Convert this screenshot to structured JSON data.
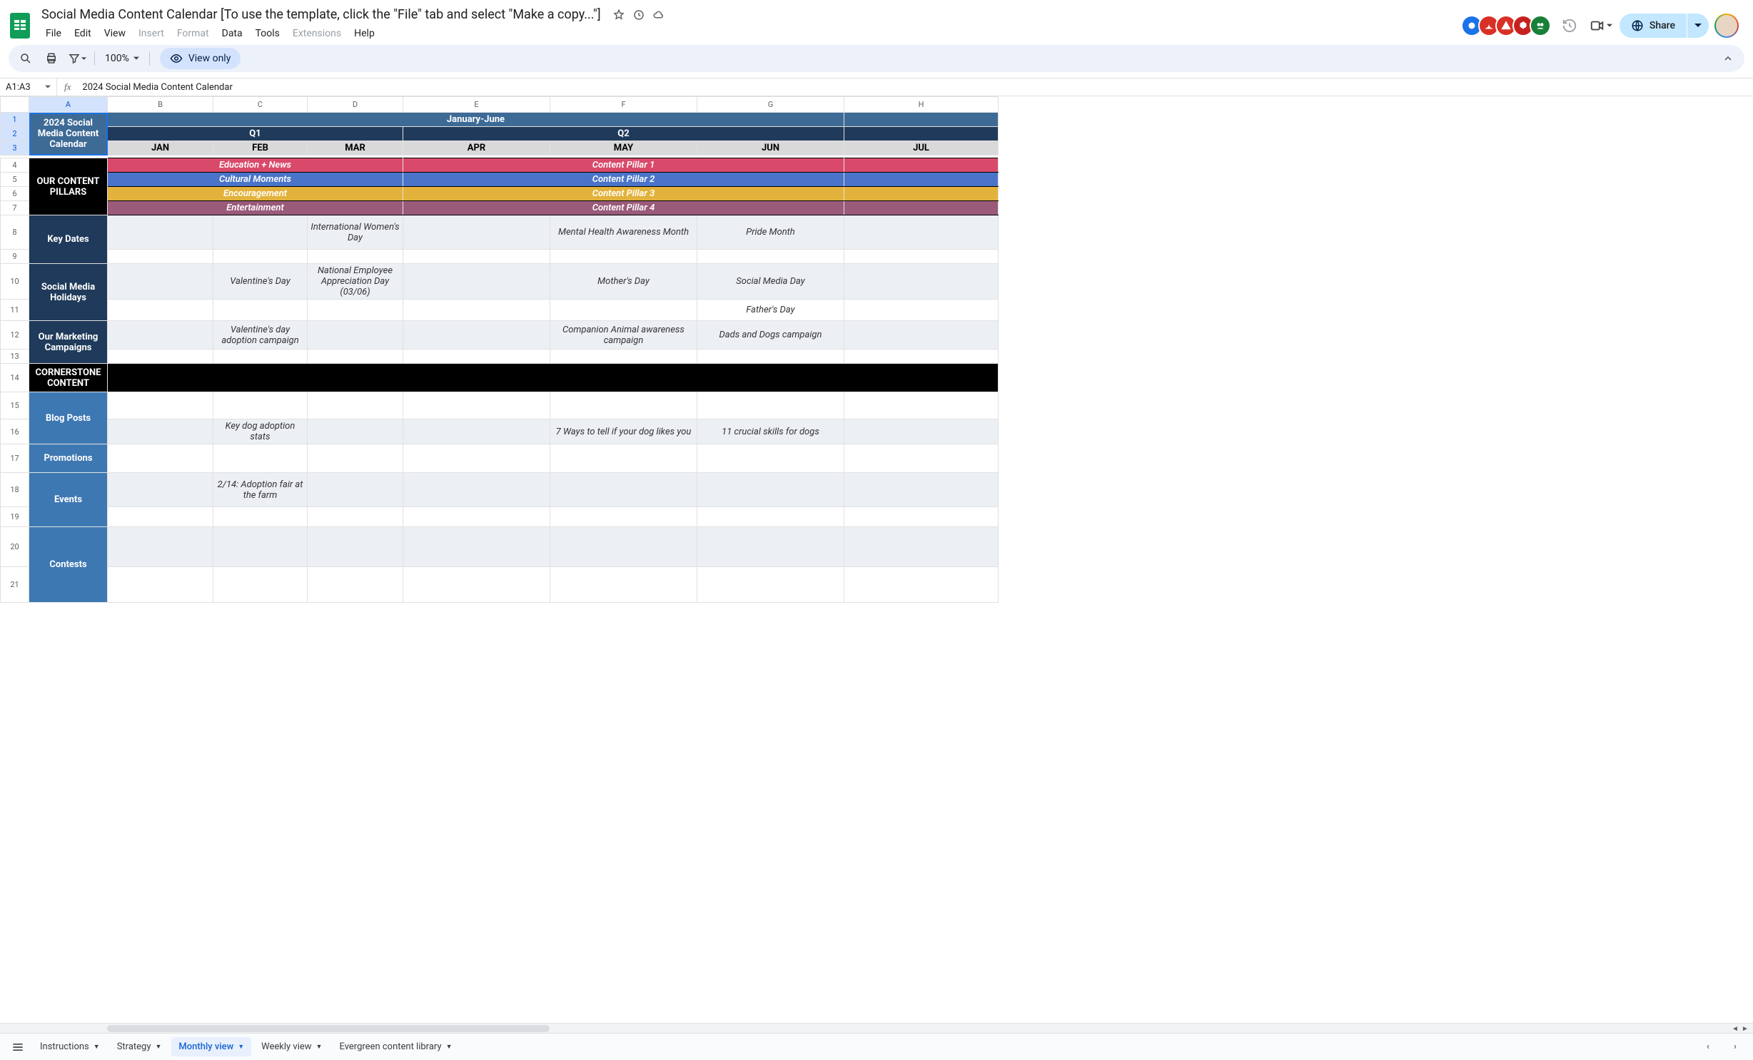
{
  "doc": {
    "title": "Social Media Content Calendar [To use the template, click the \"File\" tab and select \"Make a copy...\"]"
  },
  "menus": {
    "file": "File",
    "edit": "Edit",
    "view": "View",
    "insert": "Insert",
    "format": "Format",
    "data": "Data",
    "tools": "Tools",
    "extensions": "Extensions",
    "help": "Help"
  },
  "toolbar": {
    "zoom": "100%",
    "view_only": "View only"
  },
  "share": {
    "label": "Share"
  },
  "formula": {
    "name_box": "A1:A3",
    "value": "2024 Social Media Content Calendar"
  },
  "columns": [
    "A",
    "B",
    "C",
    "D",
    "E",
    "F",
    "G",
    "H"
  ],
  "rows": [
    "1",
    "2",
    "3",
    "4",
    "5",
    "6",
    "7",
    "8",
    "9",
    "10",
    "11",
    "12",
    "13",
    "14",
    "15",
    "16",
    "17",
    "18",
    "19",
    "20",
    "21"
  ],
  "calendar": {
    "title": "2024 Social Media Content Calendar",
    "span": "January-June",
    "q1": "Q1",
    "q2": "Q2",
    "months": {
      "jan": "JAN",
      "feb": "FEB",
      "mar": "MAR",
      "apr": "APR",
      "may": "MAY",
      "jun": "JUN",
      "jul": "JUL"
    },
    "pillars_label": "OUR CONTENT PILLARS",
    "pillars_q1": {
      "p1": "Education + News",
      "p2": "Cultural Moments",
      "p3": "Encouragement",
      "p4": "Entertainment"
    },
    "pillars_q2": {
      "p1": "Content Pillar 1",
      "p2": "Content Pillar 2",
      "p3": "Content Pillar 3",
      "p4": "Content Pillar 4"
    },
    "key_dates_label": "Key Dates",
    "key_dates": {
      "mar": "International Women's Day",
      "may": "Mental Health Awareness Month",
      "jun": "Pride Month"
    },
    "holidays_label": "Social Media Holidays",
    "holidays": {
      "feb": "Valentine's Day",
      "mar": "National Employee Appreciation Day (03/06)",
      "may": "Mother's Day",
      "jun_a": "Social Media Day",
      "jun_b": "Father's Day"
    },
    "campaigns_label": "Our Marketing Campaigns",
    "campaigns": {
      "feb": "Valentine's day adoption campaign",
      "may": "Companion Animal awareness campaign",
      "jun": "Dads and Dogs campaign"
    },
    "cornerstone_label": "CORNERSTONE CONTENT",
    "blog_label": "Blog Posts",
    "blog": {
      "feb": "Key dog adoption stats",
      "may": "7 Ways to tell if your dog likes you",
      "jun": "11 crucial skills for dogs"
    },
    "promotions_label": "Promotions",
    "events_label": "Events",
    "events": {
      "feb": "2/14: Adoption fair at the farm"
    },
    "contests_label": "Contests"
  },
  "tabs": {
    "instructions": "Instructions",
    "strategy": "Strategy",
    "monthly": "Monthly view",
    "weekly": "Weekly view",
    "evergreen": "Evergreen content library"
  },
  "avatar_colors": [
    "#1a73e8",
    "#d93025",
    "#d93025",
    "#c5221f",
    "#188038"
  ]
}
